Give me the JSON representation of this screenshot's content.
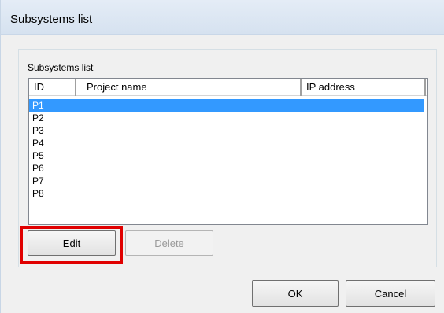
{
  "window": {
    "title": "Subsystems list"
  },
  "group": {
    "label": "Subsystems list"
  },
  "listview": {
    "columns": [
      "ID",
      "Project name",
      "IP address"
    ],
    "rows": [
      {
        "id": "P1",
        "project": "",
        "ip": "",
        "selected": true
      },
      {
        "id": "P2",
        "project": "",
        "ip": "",
        "selected": false
      },
      {
        "id": "P3",
        "project": "",
        "ip": "",
        "selected": false
      },
      {
        "id": "P4",
        "project": "",
        "ip": "",
        "selected": false
      },
      {
        "id": "P5",
        "project": "",
        "ip": "",
        "selected": false
      },
      {
        "id": "P6",
        "project": "",
        "ip": "",
        "selected": false
      },
      {
        "id": "P7",
        "project": "",
        "ip": "",
        "selected": false
      },
      {
        "id": "P8",
        "project": "",
        "ip": "",
        "selected": false
      }
    ],
    "selection_color": "#3399ff"
  },
  "buttons": {
    "edit": "Edit",
    "delete": "Delete",
    "ok": "OK",
    "cancel": "Cancel"
  },
  "highlight_color": "#e00000"
}
